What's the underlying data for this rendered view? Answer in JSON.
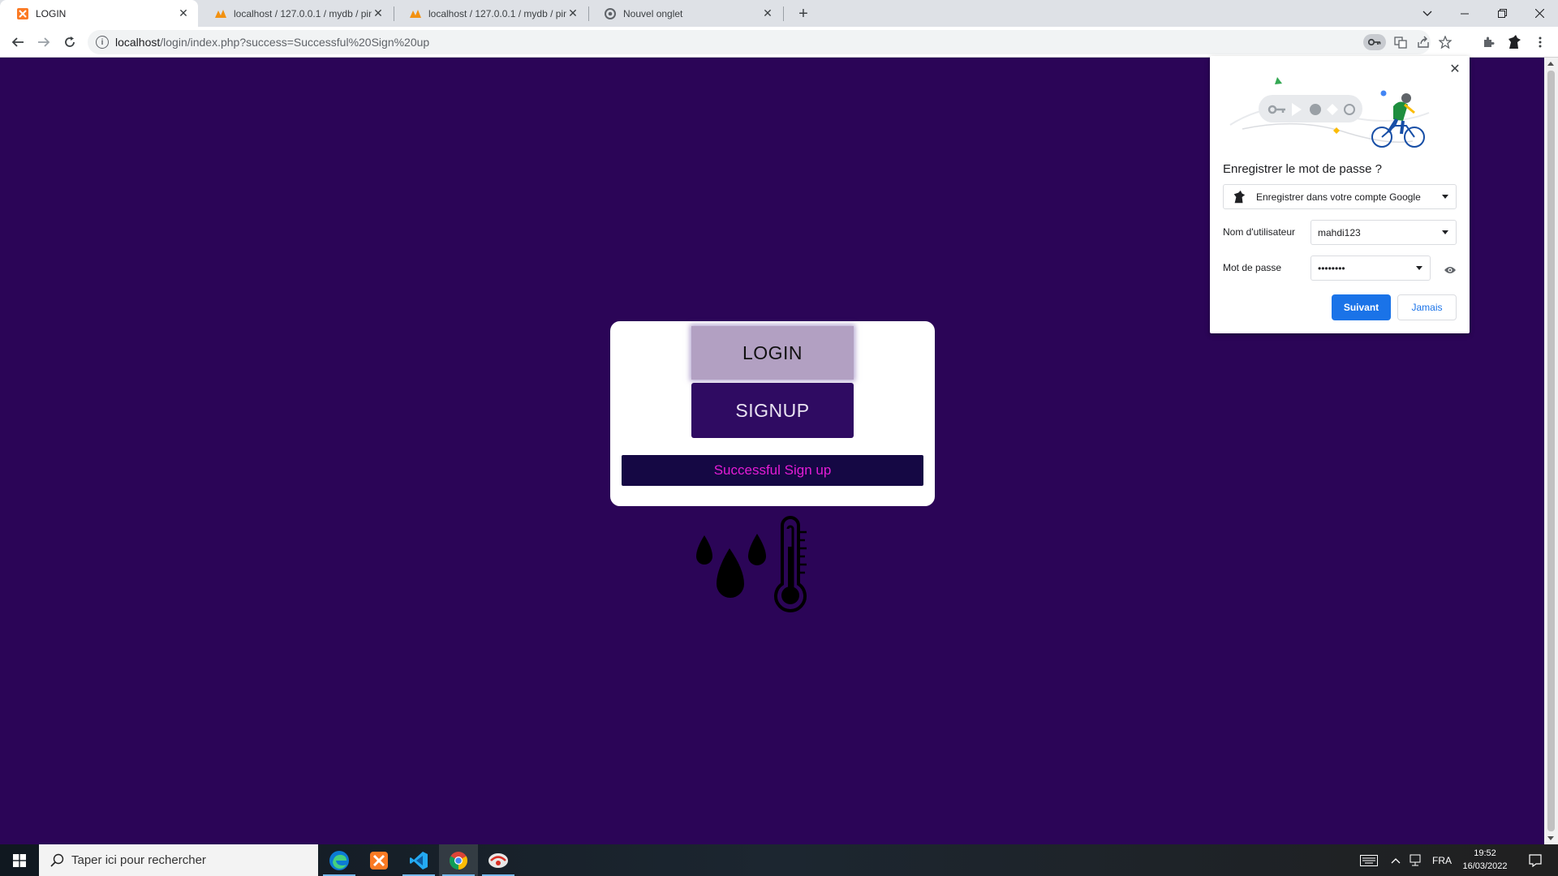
{
  "browser": {
    "tabs": [
      {
        "title": "LOGIN",
        "active": true,
        "favicon": "xampp-icon"
      },
      {
        "title": "localhost / 127.0.0.1 / mydb / pin",
        "active": false,
        "favicon": "phpmyadmin-icon"
      },
      {
        "title": "localhost / 127.0.0.1 / mydb / pin",
        "active": false,
        "favicon": "phpmyadmin-icon"
      },
      {
        "title": "Nouvel onglet",
        "active": false,
        "favicon": "chrome-icon"
      }
    ],
    "url_host": "localhost",
    "url_path": "/login/index.php?success=Successful%20Sign%20up"
  },
  "page": {
    "login_label": "LOGIN",
    "signup_label": "SIGNUP",
    "message": "Successful Sign up",
    "background_color": "#2b0557",
    "message_color": "#e41cd5"
  },
  "password_prompt": {
    "title": "Enregistrer le mot de passe ?",
    "account_option": "Enregistrer dans votre compte Google",
    "username_label": "Nom d'utilisateur",
    "username_value": "mahdi123",
    "password_label": "Mot de passe",
    "password_value": "••••••••",
    "primary_button": "Suivant",
    "secondary_button": "Jamais",
    "accent_color": "#1a73e8"
  },
  "taskbar": {
    "search_placeholder": "Taper ici pour rechercher",
    "language": "FRA",
    "time": "19:52",
    "date": "16/03/2022",
    "apps": [
      "edge-icon",
      "xampp-icon",
      "vscode-icon",
      "chrome-icon",
      "app-icon"
    ]
  }
}
